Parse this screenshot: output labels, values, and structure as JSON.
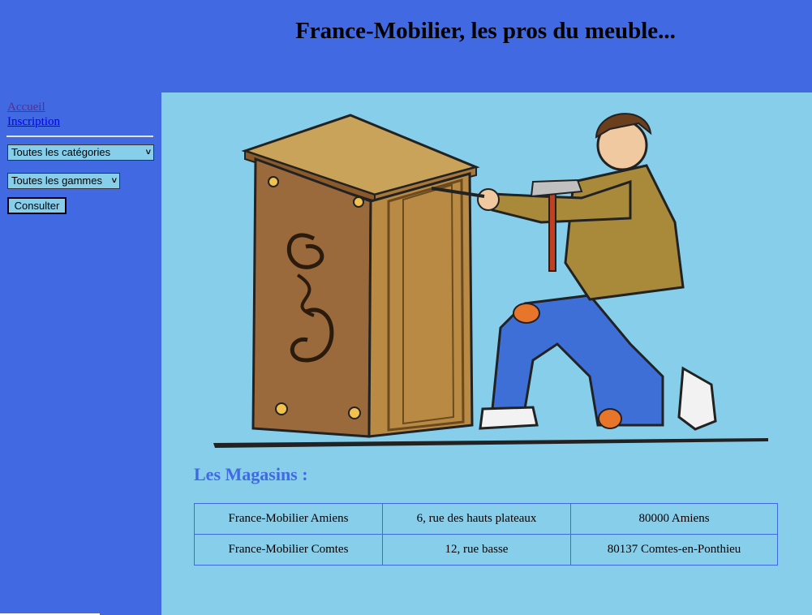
{
  "header": {
    "title": "France-Mobilier, les pros du meuble..."
  },
  "sidebar": {
    "links": [
      {
        "label": "Accueil"
      },
      {
        "label": "Inscription"
      }
    ],
    "category_select": {
      "selected": "Toutes les catégories"
    },
    "range_select": {
      "selected": "Toutes les gammes"
    },
    "consult_label": "Consulter"
  },
  "main": {
    "stores_heading": "Les Magasins :",
    "stores": [
      {
        "name": "France-Mobilier Amiens",
        "address": "6, rue des hauts plateaux",
        "city": "80000 Amiens"
      },
      {
        "name": "France-Mobilier Comtes",
        "address": "12, rue basse",
        "city": "80137 Comtes-en-Ponthieu"
      }
    ]
  },
  "colors": {
    "frame_blue": "#4169e1",
    "content_sky": "#87ceeb"
  },
  "icons": [
    "chevron-down-icon",
    "carpenter-illustration"
  ]
}
